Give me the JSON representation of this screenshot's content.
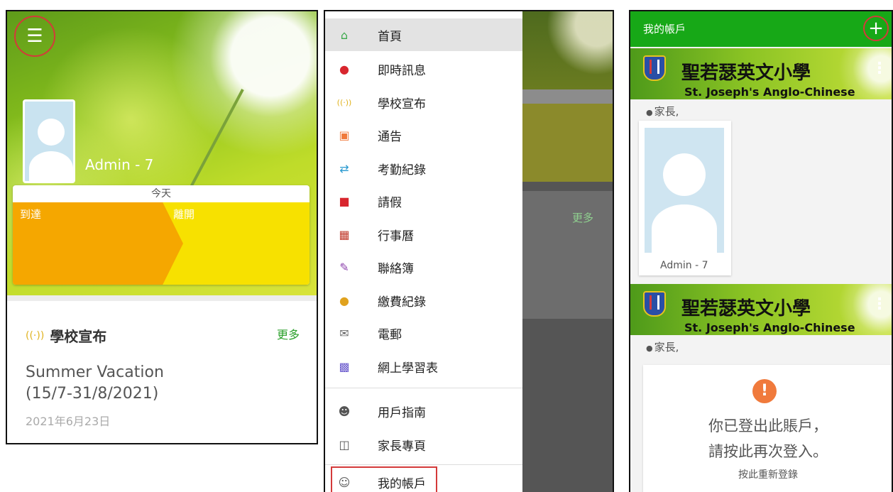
{
  "panel1": {
    "menu_icon": "hamburger-icon",
    "user_name": "Admin - 7",
    "attendance": {
      "today": "今天",
      "arrive": "到達",
      "leave": "離開"
    },
    "news": {
      "icon": "broadcast-icon",
      "title": "學校宣布",
      "more": "更多",
      "item_line1": "Summer Vacation",
      "item_line2": "(15/7-31/8/2021)",
      "date": "2021年6月23日"
    },
    "colors": {
      "arrive": "#f5a700",
      "leave": "#f7e100",
      "accent": "#2aa02a"
    }
  },
  "panel2": {
    "background_more": "更多",
    "menu": [
      {
        "label": "首頁",
        "icon": "home-icon",
        "active": true
      },
      {
        "label": "即時訊息",
        "icon": "message-icon"
      },
      {
        "label": "學校宣布",
        "icon": "broadcast-icon"
      },
      {
        "label": "通告",
        "icon": "notice-icon"
      },
      {
        "label": "考勤紀錄",
        "icon": "attendance-arrows-icon"
      },
      {
        "label": "請假",
        "icon": "leave-icon"
      },
      {
        "label": "行事曆",
        "icon": "calendar-icon"
      },
      {
        "label": "聯絡簿",
        "icon": "contact-book-icon"
      },
      {
        "label": "繳費紀錄",
        "icon": "payment-icon"
      },
      {
        "label": "電郵",
        "icon": "mail-icon"
      },
      {
        "label": "網上學習表",
        "icon": "learning-sheet-icon"
      },
      {
        "label": "用戶指南",
        "icon": "user-guide-icon"
      },
      {
        "label": "家長專頁",
        "icon": "parent-page-icon"
      },
      {
        "label": "我的帳戶",
        "icon": "my-account-icon"
      }
    ]
  },
  "panel3": {
    "title": "我的帳戶",
    "add_icon": "plus-icon",
    "accounts": [
      {
        "school_zh": "聖若瑟英文小學",
        "school_en": "St. Joseph's Anglo-Chinese",
        "role": "家長,",
        "name": "Admin - 7"
      },
      {
        "school_zh": "聖若瑟英文小學",
        "school_en": "St. Joseph's Anglo-Chinese",
        "role": "家長,"
      }
    ],
    "logout": {
      "line1": "你已登出此賬戶，",
      "line2": "請按此再次登入。",
      "relogin": "按此重新登錄"
    },
    "colors": {
      "topbar": "#17a817",
      "warning": "#f07a3c"
    }
  }
}
